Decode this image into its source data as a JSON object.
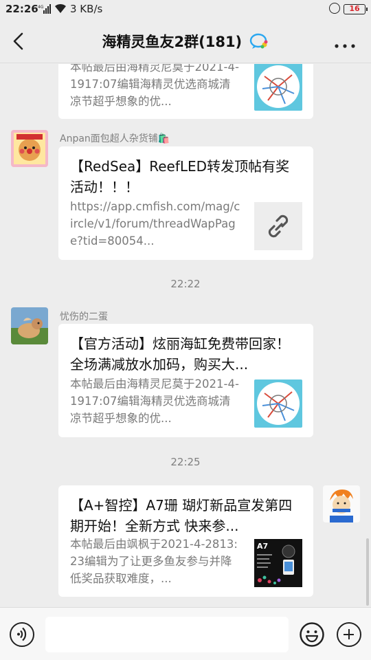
{
  "status_bar": {
    "time": "22:26",
    "network": "4G",
    "speed": "3 KB/s",
    "battery": "16"
  },
  "header": {
    "title": "海精灵鱼友2群(181)"
  },
  "messages": [
    {
      "desc": "本帖最后由海精灵尼莫于2021-4-1917:07编辑海精灵优选商城清凉节超乎想象的优..."
    },
    {
      "sender": "Anpan面包超人杂货铺🛍️",
      "title": "【RedSea】ReefLED转发顶帖有奖活动！！！",
      "desc": "https://app.cmfish.com/mag/circle/v1/forum/threadWapPage?tid=80054..."
    },
    {
      "timestamp": "22:22"
    },
    {
      "sender": "忧伤的二蛋",
      "title": "【官方活动】炫丽海缸免费带回家！全场满减放水加码，购买大...",
      "desc": "本帖最后由海精灵尼莫于2021-4-1917:07编辑海精灵优选商城清凉节超乎想象的优..."
    },
    {
      "timestamp": "22:25"
    },
    {
      "title": "【A+智控】A7珊 瑚灯新品宣发第四期开始！全新方式 快来参...",
      "desc": "本帖最后由飒枫于2021-4-2813:23编辑为了让更多鱼友参与并降低奖品获取难度，...",
      "thumb_label": "A7"
    }
  ],
  "colors": {
    "background": "#ededed",
    "card": "#ffffff",
    "battery_low": "#d8262c"
  },
  "icons": {
    "back": "back-arrow-icon",
    "more": "more-icon",
    "voice": "voice-icon",
    "emoji": "emoji-icon",
    "plus": "plus-icon",
    "link": "link-icon"
  }
}
